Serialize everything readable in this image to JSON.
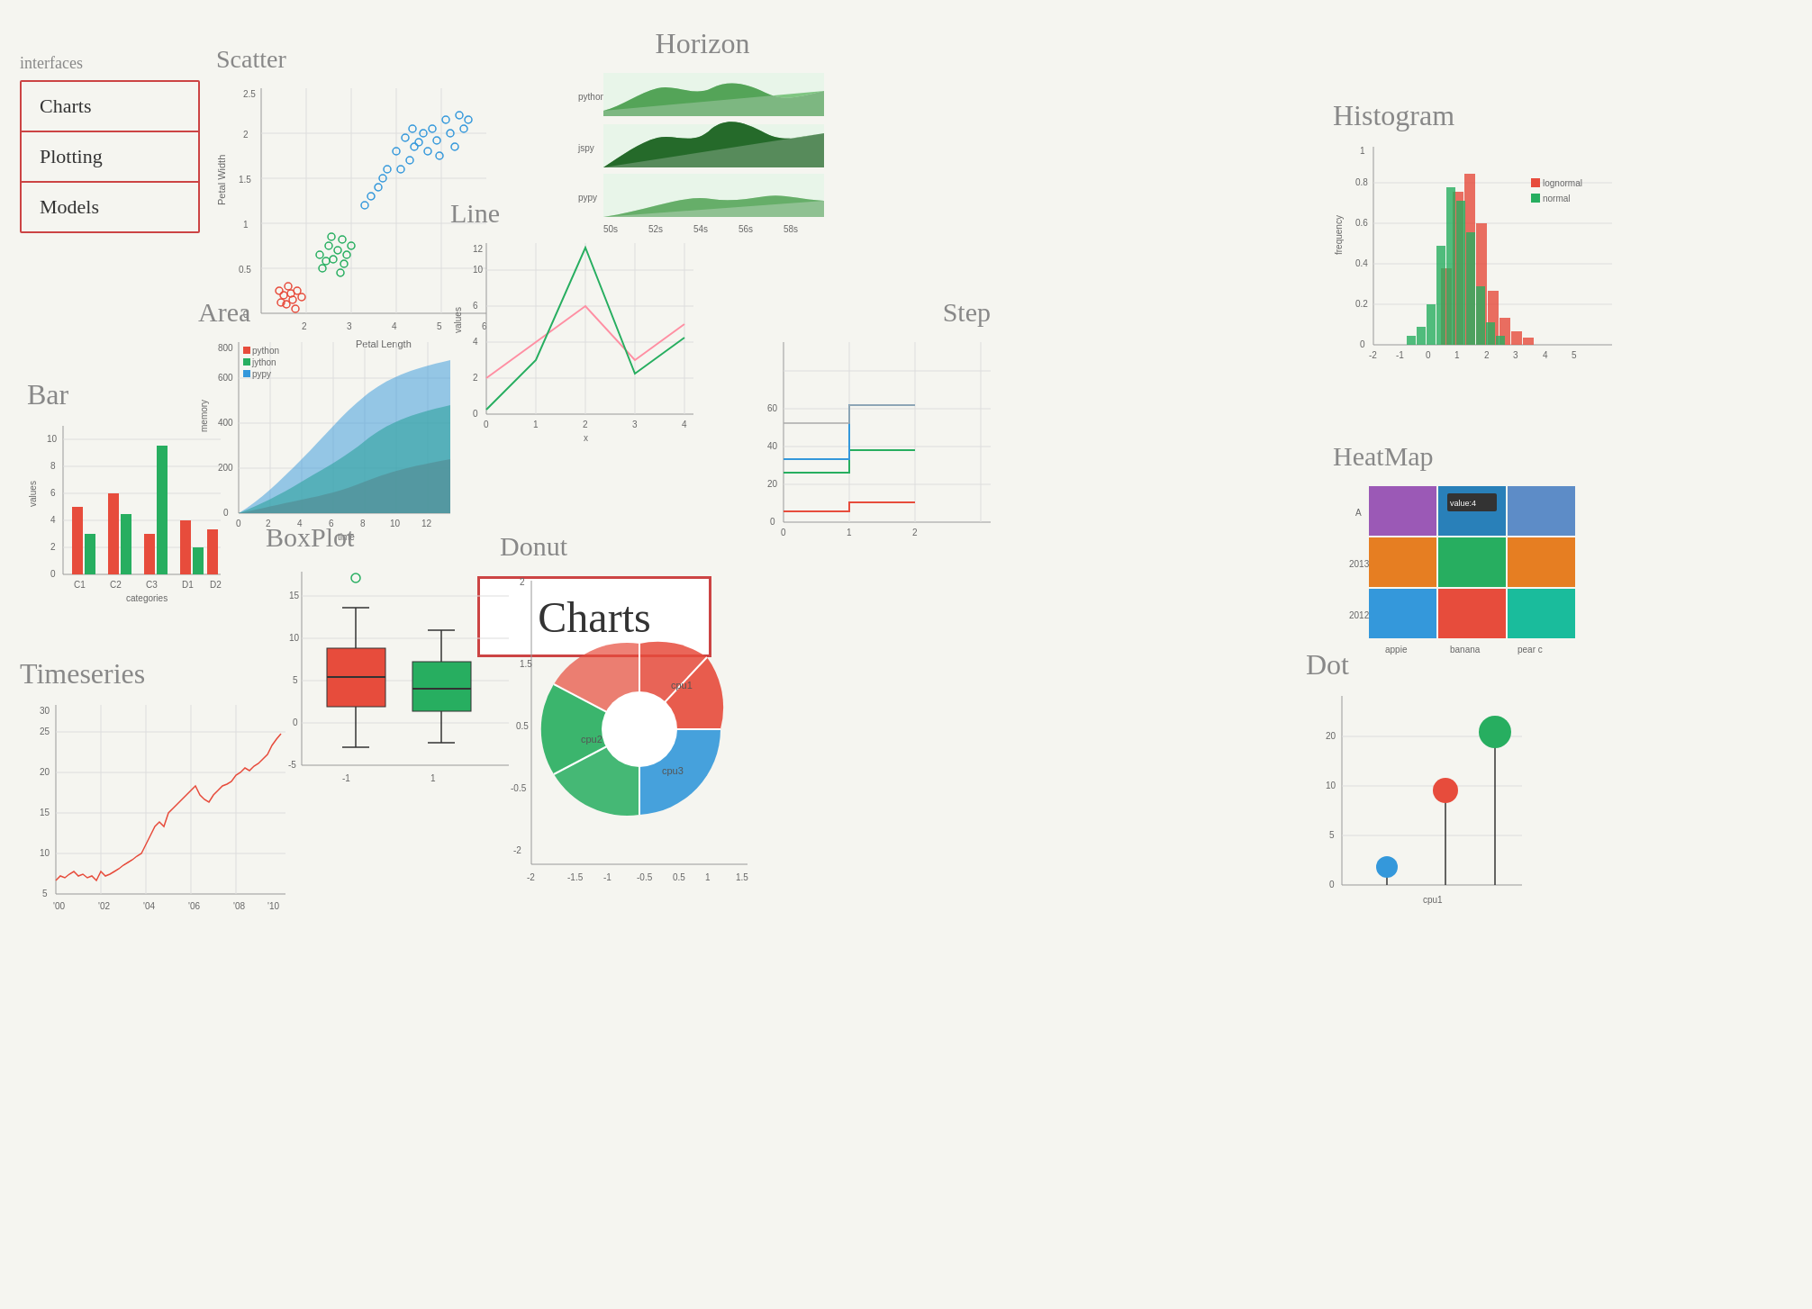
{
  "sidebar": {
    "interfaces_label": "interfaces",
    "items": [
      {
        "label": "Charts"
      },
      {
        "label": "Plotting"
      },
      {
        "label": "Models"
      }
    ]
  },
  "charts_label": "Charts",
  "titles": {
    "scatter": "Scatter",
    "horizon": "Horizon",
    "histogram": "Histogram",
    "line": "Line",
    "area": "Area",
    "step": "Step",
    "bar": "Bar",
    "boxplot": "BoxPlot",
    "donut": "Donut",
    "heatmap": "HeatMap",
    "dot": "Dot",
    "timeseries": "Timeseries"
  },
  "colors": {
    "red": "#e74c3c",
    "blue": "#3498db",
    "green": "#27ae60",
    "dark_green": "#1a6b2c",
    "purple": "#9b59b6",
    "orange": "#e67e22",
    "teal": "#1abc9c",
    "pink": "#ff69b4",
    "sidebar_border": "#c44444"
  }
}
